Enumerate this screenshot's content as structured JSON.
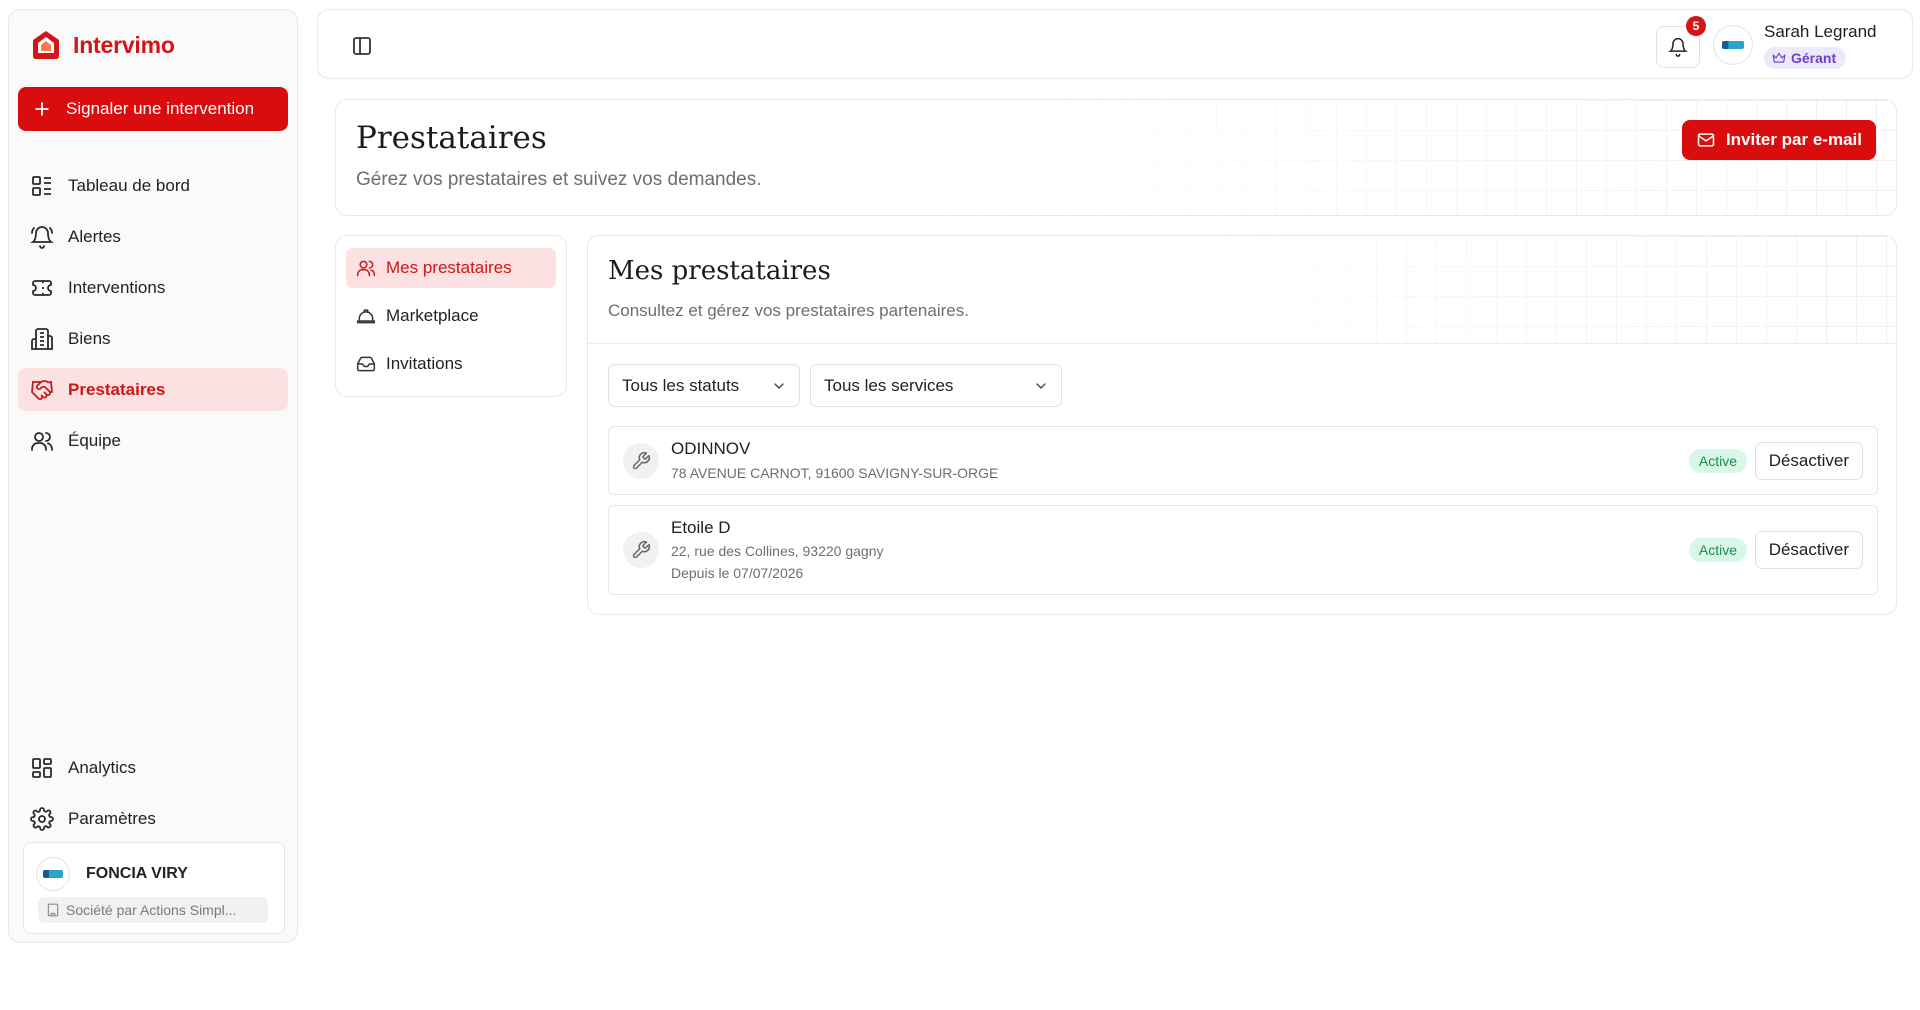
{
  "brand": {
    "name": "Intervimo",
    "accent": "#d90d0d"
  },
  "sidebar": {
    "cta_label": "Signaler une intervention",
    "items": [
      {
        "label": "Tableau de bord",
        "icon": "dashboard-icon"
      },
      {
        "label": "Alertes",
        "icon": "bell-icon"
      },
      {
        "label": "Interventions",
        "icon": "ticket-icon"
      },
      {
        "label": "Biens",
        "icon": "building-icon"
      },
      {
        "label": "Prestataires",
        "icon": "handshake-icon",
        "active": true
      },
      {
        "label": "Équipe",
        "icon": "users-icon"
      }
    ],
    "bottom_items": [
      {
        "label": "Analytics",
        "icon": "grid-icon"
      },
      {
        "label": "Paramètres",
        "icon": "gear-icon"
      }
    ],
    "org": {
      "name": "FONCIA VIRY",
      "type": "Société par Actions Simpl..."
    }
  },
  "topbar": {
    "notification_count": "5",
    "user_name": "Sarah Legrand",
    "user_role": "Gérant"
  },
  "header": {
    "title": "Prestataires",
    "subtitle": "Gérez vos prestataires et suivez vos demandes.",
    "invite_label": "Inviter par e-mail"
  },
  "subnav": {
    "items": [
      {
        "label": "Mes prestataires",
        "icon": "users-icon",
        "active": true
      },
      {
        "label": "Marketplace",
        "icon": "hard-hat-icon"
      },
      {
        "label": "Invitations",
        "icon": "inbox-icon"
      }
    ]
  },
  "content": {
    "title": "Mes prestataires",
    "subtitle": "Consultez et gérez vos prestataires partenaires.",
    "filters": {
      "status": "Tous les statuts",
      "service": "Tous les services"
    },
    "providers": [
      {
        "name": "ODINNOV",
        "address": "78 AVENUE CARNOT, 91600 SAVIGNY-SUR-ORGE",
        "since": "",
        "status": "Active",
        "action": "Désactiver"
      },
      {
        "name": "Etoile D",
        "address": "22, rue des Collines, 93220 gagny",
        "since": "Depuis le 07/07/2026",
        "status": "Active",
        "action": "Désactiver"
      }
    ]
  },
  "colors": {
    "active_bg": "#fbe1e1",
    "active_text": "#d11616",
    "status_green": "#1a8a4f",
    "role_purple": "#6b3fd0"
  }
}
